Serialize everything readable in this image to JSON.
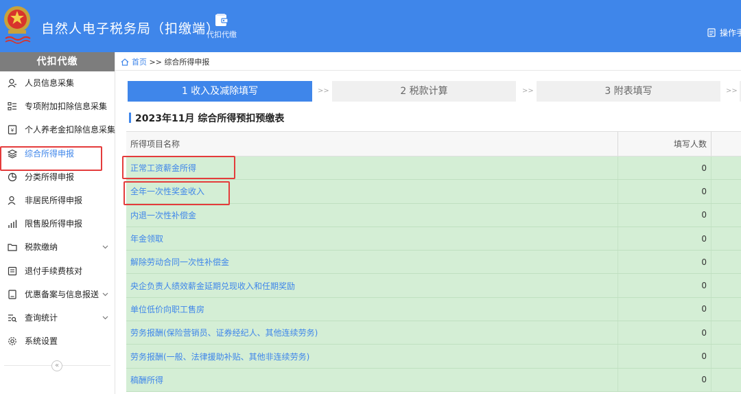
{
  "header": {
    "app_title": "自然人电子税务局（扣缴端）",
    "nav_label": "代扣代缴",
    "ops_label": "操作手"
  },
  "sidebar": {
    "heading": "代扣代缴",
    "items": [
      {
        "label": "人员信息采集",
        "icon": "person-icon"
      },
      {
        "label": "专项附加扣除信息采集",
        "icon": "list-icon"
      },
      {
        "label": "个人养老金扣除信息采集",
        "icon": "pension-icon"
      },
      {
        "label": "综合所得申报",
        "icon": "layers-icon",
        "active": true
      },
      {
        "label": "分类所得申报",
        "icon": "pie-icon"
      },
      {
        "label": "非居民所得申报",
        "icon": "user-icon"
      },
      {
        "label": "限售股所得申报",
        "icon": "bar-chart-icon"
      },
      {
        "label": "税款缴纳",
        "icon": "folder-icon",
        "expandable": true
      },
      {
        "label": "退付手续费核对",
        "icon": "ledger-icon"
      },
      {
        "label": "优惠备案与信息报送",
        "icon": "document-icon",
        "expandable": true
      },
      {
        "label": "查询统计",
        "icon": "query-icon",
        "expandable": true
      },
      {
        "label": "系统设置",
        "icon": "gear-icon"
      }
    ],
    "collapse_glyph": "«"
  },
  "breadcrumb": {
    "home": "首页",
    "separator": ">>",
    "current": "综合所得申报"
  },
  "steps": [
    {
      "label": "1 收入及减除填写",
      "active": true
    },
    {
      "label": "2 税款计算",
      "active": false
    },
    {
      "label": "3 附表填写",
      "active": false
    }
  ],
  "step_separator": ">>",
  "section_title": "2023年11月  综合所得预扣预缴表",
  "table": {
    "columns": [
      "所得项目名称",
      "填写人数"
    ],
    "rows": [
      {
        "name": "正常工资薪金所得",
        "count": "0"
      },
      {
        "name": "全年一次性奖金收入",
        "count": "0"
      },
      {
        "name": "内退一次性补偿金",
        "count": "0"
      },
      {
        "name": "年金领取",
        "count": "0"
      },
      {
        "name": "解除劳动合同一次性补偿金",
        "count": "0"
      },
      {
        "name": "央企负责人绩效薪金延期兑现收入和任期奖励",
        "count": "0"
      },
      {
        "name": "单位低价向职工售房",
        "count": "0"
      },
      {
        "name": "劳务报酬(保险营销员、证券经纪人、其他连续劳务)",
        "count": "0"
      },
      {
        "name": "劳务报酬(一般、法律援助补贴、其他非连续劳务)",
        "count": "0"
      },
      {
        "name": "稿酬所得",
        "count": "0"
      }
    ]
  },
  "colors": {
    "primary": "#3f86ea",
    "row_bg": "#d4eed5",
    "highlight_box": "#e43b3b",
    "sidebar_head": "#7d7d7d"
  }
}
